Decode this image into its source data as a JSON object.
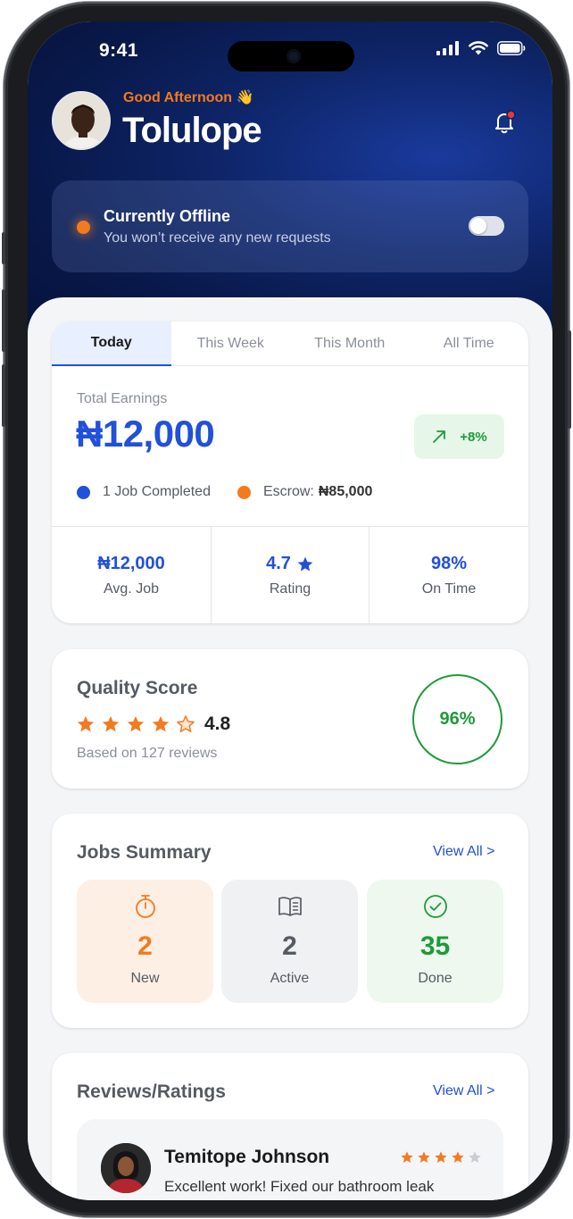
{
  "status_bar": {
    "time": "9:41",
    "icons": [
      "signal-icon",
      "wifi-icon",
      "battery-icon"
    ]
  },
  "header": {
    "greeting": "Good Afternoon 👋",
    "user_name": "Tolulope",
    "icons": [
      "avatar",
      "bell-notification-icon"
    ]
  },
  "availability": {
    "title": "Currently Offline",
    "subtitle": "You won’t receive any new requests",
    "online": false
  },
  "earnings": {
    "tabs": [
      {
        "label": "Today",
        "active": true
      },
      {
        "label": "This Week",
        "active": false
      },
      {
        "label": "This Month",
        "active": false
      },
      {
        "label": "All Time",
        "active": false
      }
    ],
    "total_label": "Total Earnings",
    "total_amount": "₦12,000",
    "trend": "+8%",
    "jobs_completed": "1 Job Completed",
    "escrow_label": "Escrow:",
    "escrow_amount": "₦85,000",
    "stats": [
      {
        "value": "₦12,000",
        "label": "Avg. Job"
      },
      {
        "value": "4.7",
        "label": "Rating"
      },
      {
        "value": "98%",
        "label": "On Time"
      }
    ]
  },
  "quality": {
    "title": "Quality Score",
    "rating": "4.8",
    "star_count": 4.8,
    "reviews_text": "Based on 127 reviews",
    "score": "96%"
  },
  "jobs_summary": {
    "title": "Jobs Summary",
    "view_all": "View All >",
    "tiles": [
      {
        "count": "2",
        "label": "New",
        "icon": "stopwatch-icon"
      },
      {
        "count": "2",
        "label": "Active",
        "icon": "open-book-icon"
      },
      {
        "count": "35",
        "label": "Done",
        "icon": "check-circle-icon"
      }
    ]
  },
  "reviews": {
    "title": "Reviews/Ratings",
    "view_all": "View All >",
    "items": [
      {
        "name": "Temitope Johnson",
        "stars": 4,
        "text": "Excellent work! Fixed our bathroom leak"
      }
    ]
  },
  "colors": {
    "brand_blue": "#2150d9",
    "accent_orange": "#f37a1f",
    "success_green": "#1f9a3a",
    "hero_navy": "#081849"
  }
}
